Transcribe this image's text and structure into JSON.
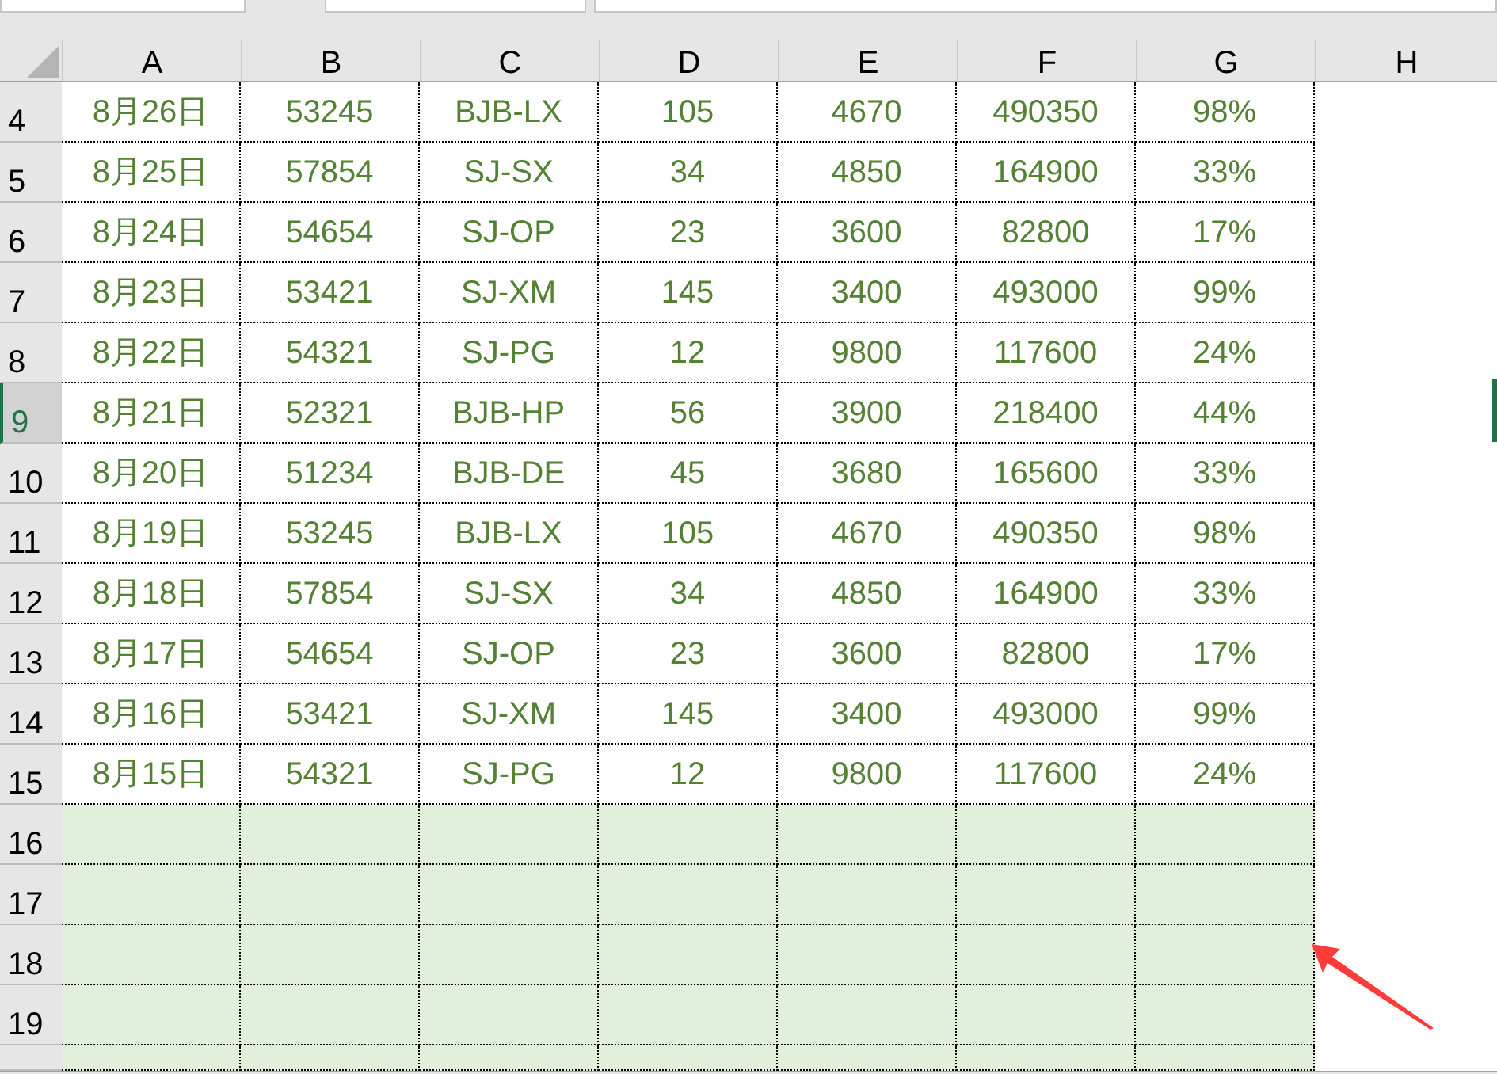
{
  "columns": [
    "A",
    "B",
    "C",
    "D",
    "E",
    "F",
    "G",
    "H"
  ],
  "rows": [
    {
      "kind": "data",
      "number": "4",
      "selected": false,
      "cells": [
        "8月26日",
        "53245",
        "BJB-LX",
        "105",
        "4670",
        "490350",
        "98%"
      ]
    },
    {
      "kind": "data",
      "number": "5",
      "selected": false,
      "cells": [
        "8月25日",
        "57854",
        "SJ-SX",
        "34",
        "4850",
        "164900",
        "33%"
      ]
    },
    {
      "kind": "data",
      "number": "6",
      "selected": false,
      "cells": [
        "8月24日",
        "54654",
        "SJ-OP",
        "23",
        "3600",
        "82800",
        "17%"
      ]
    },
    {
      "kind": "data",
      "number": "7",
      "selected": false,
      "cells": [
        "8月23日",
        "53421",
        "SJ-XM",
        "145",
        "3400",
        "493000",
        "99%"
      ]
    },
    {
      "kind": "data",
      "number": "8",
      "selected": false,
      "cells": [
        "8月22日",
        "54321",
        "SJ-PG",
        "12",
        "9800",
        "117600",
        "24%"
      ]
    },
    {
      "kind": "data",
      "number": "9",
      "selected": true,
      "cells": [
        "8月21日",
        "52321",
        "BJB-HP",
        "56",
        "3900",
        "218400",
        "44%"
      ]
    },
    {
      "kind": "data",
      "number": "10",
      "selected": false,
      "cells": [
        "8月20日",
        "51234",
        "BJB-DE",
        "45",
        "3680",
        "165600",
        "33%"
      ]
    },
    {
      "kind": "data",
      "number": "11",
      "selected": false,
      "cells": [
        "8月19日",
        "53245",
        "BJB-LX",
        "105",
        "4670",
        "490350",
        "98%"
      ]
    },
    {
      "kind": "data",
      "number": "12",
      "selected": false,
      "cells": [
        "8月18日",
        "57854",
        "SJ-SX",
        "34",
        "4850",
        "164900",
        "33%"
      ]
    },
    {
      "kind": "data",
      "number": "13",
      "selected": false,
      "cells": [
        "8月17日",
        "54654",
        "SJ-OP",
        "23",
        "3600",
        "82800",
        "17%"
      ]
    },
    {
      "kind": "data",
      "number": "14",
      "selected": false,
      "cells": [
        "8月16日",
        "53421",
        "SJ-XM",
        "145",
        "3400",
        "493000",
        "99%"
      ]
    },
    {
      "kind": "data",
      "number": "15",
      "selected": false,
      "cells": [
        "8月15日",
        "54321",
        "SJ-PG",
        "12",
        "9800",
        "117600",
        "24%"
      ]
    },
    {
      "kind": "empty",
      "number": "16",
      "selected": false
    },
    {
      "kind": "empty",
      "number": "17",
      "selected": false
    },
    {
      "kind": "empty",
      "number": "18",
      "selected": false
    },
    {
      "kind": "empty",
      "number": "19",
      "selected": false
    },
    {
      "kind": "empty",
      "selected": false
    }
  ]
}
